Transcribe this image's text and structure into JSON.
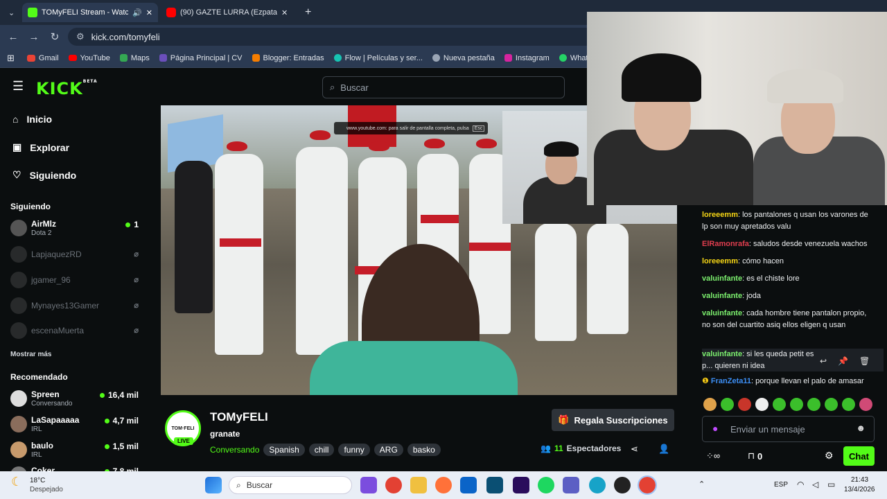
{
  "browser": {
    "tabs": [
      {
        "title": "TOMyFELI Stream - Watch l",
        "color": "#53fc18"
      },
      {
        "title": "(90) GAZTE LURRA (Ezpatadant...",
        "color": "#ff0000"
      }
    ],
    "url": "kick.com/tomyfeli",
    "bookmarks": [
      "Gmail",
      "YouTube",
      "Maps",
      "Página Principal | CV",
      "Blogger: Entradas",
      "Flow | Películas y ser...",
      "Nueva pestaña",
      "Instagram",
      "WhatsApp"
    ]
  },
  "kick": {
    "logo": "KICK",
    "beta": "BETA",
    "search_placeholder": "Buscar",
    "nav": [
      "Inicio",
      "Explorar",
      "Siguiendo"
    ],
    "following_title": "Siguiendo",
    "following": [
      {
        "name": "AirMlz",
        "sub": "Dota 2",
        "viewers": "1",
        "live": true
      },
      {
        "name": "LapjaquezRD",
        "live": false
      },
      {
        "name": "jgamer_96",
        "live": false
      },
      {
        "name": "Mynayes13Gamer",
        "live": false
      },
      {
        "name": "escenaMuerta",
        "live": false
      }
    ],
    "show_more": "Mostrar más",
    "recommended_title": "Recomendado",
    "recommended": [
      {
        "name": "Spreen",
        "sub": "Conversando",
        "viewers": "16,4 mil"
      },
      {
        "name": "LaSapaaaaa",
        "sub": "IRL",
        "viewers": "4,7 mil"
      },
      {
        "name": "baulo",
        "sub": "IRL",
        "viewers": "1,5 mil"
      },
      {
        "name": "Coker",
        "sub": "",
        "viewers": "7,8 mil"
      }
    ]
  },
  "player": {
    "esc_text": "www.youtube.com: para salir de pantalla completa, pulsa",
    "esc_key": "Esc"
  },
  "stream": {
    "channel": "TOMyFELI",
    "avatar_text": "TOM·FELI",
    "live": "LIVE",
    "title": "granate",
    "category": "Conversando",
    "tags": [
      "Spanish",
      "chill",
      "funny",
      "ARG",
      "basko"
    ],
    "gift": "Regala Suscripciones",
    "viewers": "11",
    "viewers_label": "Espectadores"
  },
  "chat": {
    "messages": [
      {
        "user": "loreeemm",
        "color": "#f5d515",
        "text": "los pantalones q usan los varones de lp son muy apretados valu"
      },
      {
        "user": "ElRamonrafa",
        "color": "#e23e4f",
        "text": "saludos desde venezuela wachos"
      },
      {
        "user": "loreeemm",
        "color": "#f5d515",
        "text": "cómo hacen"
      },
      {
        "user": "valuinfante",
        "color": "#7cf06e",
        "text": "es el chiste lore"
      },
      {
        "user": "valuinfante",
        "color": "#7cf06e",
        "text": "joda"
      },
      {
        "user": "valuinfante",
        "color": "#7cf06e",
        "text": "cada hombre tiene pantalon propio, no son del cuartito asiq ellos eligen q usan"
      },
      {
        "user": "valuinfante",
        "color": "#7cf06e",
        "text": "si les queda petit es p... quieren ni idea"
      },
      {
        "user": "FranZeta11",
        "color": "#3d8ff5",
        "text": "porque llevan el palo de amasar"
      }
    ],
    "input_placeholder": "Enviar un mensaje",
    "points": "0",
    "send": "Chat"
  },
  "taskbar": {
    "temp": "18°C",
    "weather": "Despejado",
    "search": "Buscar",
    "lang": "ESP",
    "time": "21:43",
    "date": "13/4/2026"
  }
}
